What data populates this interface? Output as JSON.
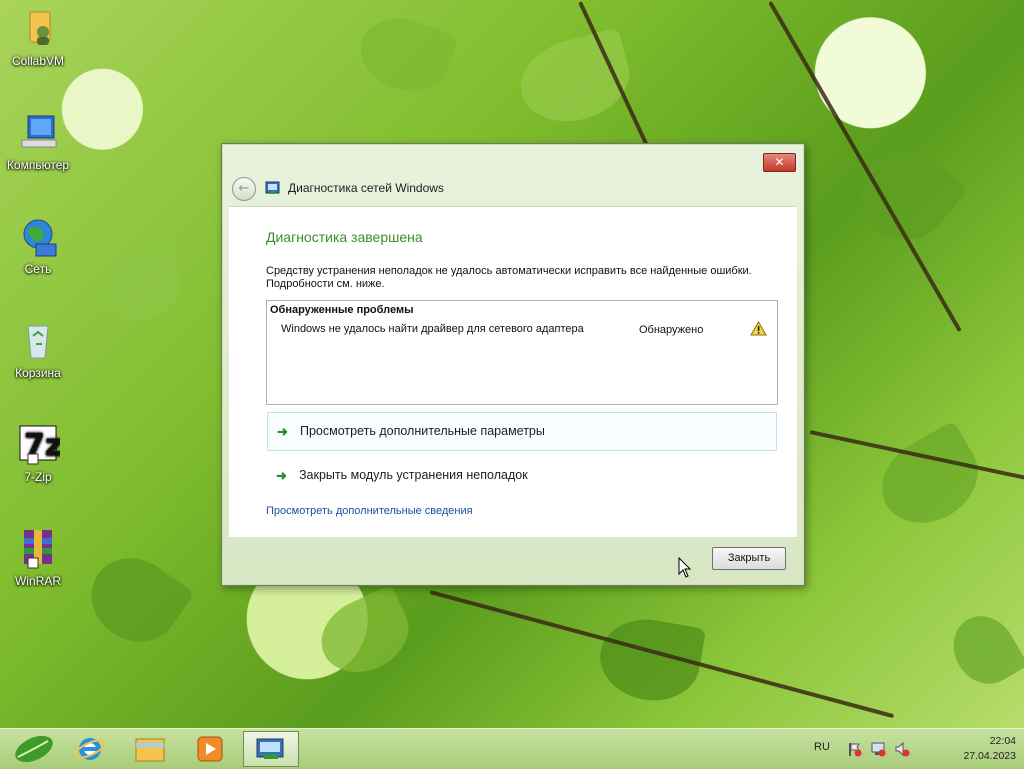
{
  "desktop": {
    "icons": [
      {
        "label": "CollabVM",
        "icon": "folder-user-icon"
      },
      {
        "label": "Компьютер",
        "icon": "computer-icon"
      },
      {
        "label": "Сеть",
        "icon": "network-icon"
      },
      {
        "label": "Корзина",
        "icon": "recycle-bin-icon"
      },
      {
        "label": "7-Zip",
        "icon": "7zip-icon"
      },
      {
        "label": "WinRAR",
        "icon": "winrar-icon"
      }
    ]
  },
  "window": {
    "title": "Диагностика сетей Windows",
    "close_symbol": "✕",
    "heading": "Диагностика завершена",
    "description": "Средству устранения неполадок не удалось автоматически исправить все найденные ошибки. Подробности см. ниже.",
    "problems": {
      "header": "Обнаруженные проблемы",
      "rows": [
        {
          "text": "Windows не удалось найти драйвер для сетевого адаптера",
          "status": "Обнаружено",
          "icon": "warning-icon"
        }
      ]
    },
    "options": [
      {
        "label": "Просмотреть дополнительные параметры",
        "selected": true
      },
      {
        "label": "Закрыть модуль устранения неполадок",
        "selected": false
      }
    ],
    "details_link": "Просмотреть дополнительные сведения",
    "close_button": "Закрыть"
  },
  "taskbar": {
    "pinned": [
      "start-leaf-icon",
      "internet-explorer-icon",
      "file-explorer-icon",
      "media-player-icon",
      "network-diagnostics-icon"
    ],
    "language": "RU",
    "time": "22:04",
    "date": "27.04.2023"
  },
  "colors": {
    "heading_green": "#3b8e2c",
    "link_blue": "#1a4fa0",
    "taskbar": "#b6d58a"
  }
}
